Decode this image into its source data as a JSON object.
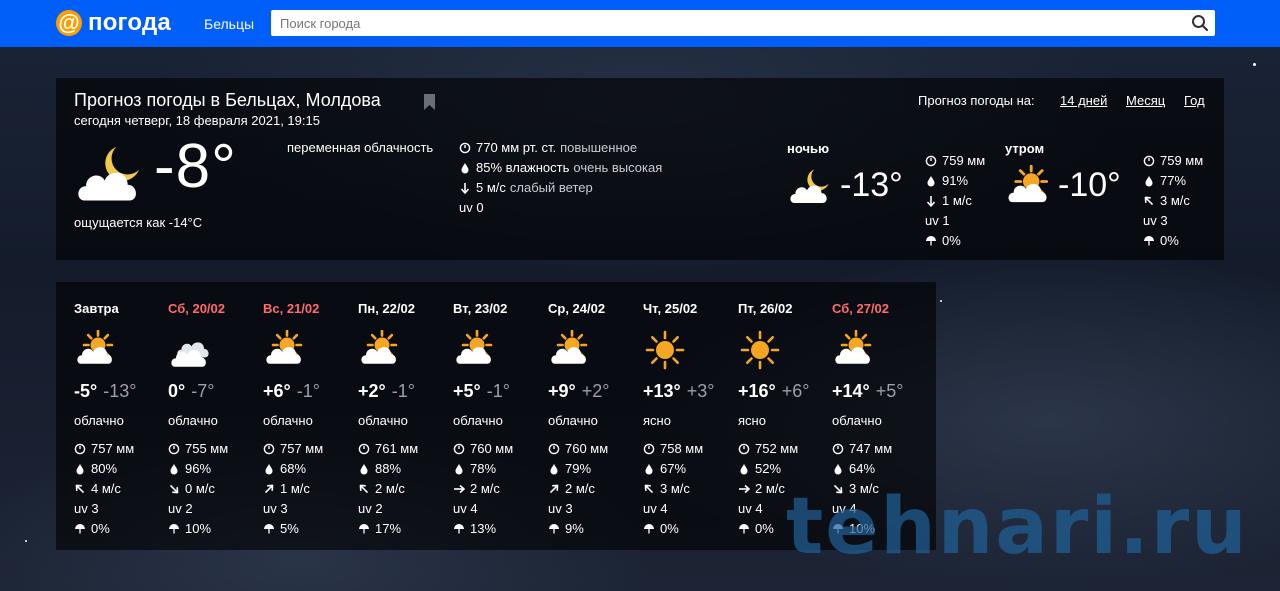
{
  "header": {
    "logo_symbol": "@",
    "logo_text": "погода",
    "city": "Бельцы",
    "search_placeholder": "Поиск города",
    "search_icon": "search-icon",
    "brand_color": "#005ff9",
    "logo_color": "#ff9e00"
  },
  "current": {
    "title": "Прогноз погоды в Бельцах, Молдова",
    "subtitle": "сегодня четверг, 18 февраля 2021, 19:15",
    "temperature": "-8°",
    "feels_like": "ощущается как -14°C",
    "condition": "переменная облачность",
    "icon": "moon-cloud-icon",
    "pressure": "770 мм рт. ст.",
    "pressure_note": "повышенное",
    "humidity": "85% влажность",
    "humidity_note": "очень высокая",
    "wind": "5 м/с",
    "wind_note": "слабый ветер",
    "uv": "uv 0"
  },
  "forecast_links": {
    "label": "Прогноз погоды на:",
    "items": [
      "14 дней",
      "Месяц",
      "Год"
    ]
  },
  "parts": [
    {
      "label": "ночью",
      "icon": "moon-cloud-icon",
      "temperature": "-13°",
      "pressure": "759 мм",
      "humidity": "91%",
      "wind": "1 м/с",
      "wind_dir": "down",
      "uv": "uv 1",
      "precip": "0%"
    },
    {
      "label": "утром",
      "icon": "sun-cloud-icon",
      "temperature": "-10°",
      "pressure": "759 мм",
      "humidity": "77%",
      "wind": "3 м/с",
      "wind_dir": "up-left",
      "uv": "uv 3",
      "precip": "0%"
    }
  ],
  "days": [
    {
      "name": "Завтра",
      "weekend": false,
      "icon": "sun-cloud-icon",
      "day": "-5°",
      "night": "-13°",
      "cond": "облачно",
      "pressure": "757 мм",
      "humidity": "80%",
      "wind": "4 м/с",
      "wind_dir": "up-left",
      "uv": "uv 3",
      "precip": "0%"
    },
    {
      "name": "Сб, 20/02",
      "weekend": true,
      "icon": "cloud-icon",
      "day": "0°",
      "night": "-7°",
      "cond": "облачно",
      "pressure": "755 мм",
      "humidity": "96%",
      "wind": "0 м/с",
      "wind_dir": "down-right",
      "uv": "uv 2",
      "precip": "10%"
    },
    {
      "name": "Вс, 21/02",
      "weekend": true,
      "icon": "sun-cloud-icon",
      "day": "+6°",
      "night": "-1°",
      "cond": "облачно",
      "pressure": "757 мм",
      "humidity": "68%",
      "wind": "1 м/с",
      "wind_dir": "up-right",
      "uv": "uv 3",
      "precip": "5%"
    },
    {
      "name": "Пн, 22/02",
      "weekend": false,
      "icon": "sun-cloud-icon",
      "day": "+2°",
      "night": "-1°",
      "cond": "облачно",
      "pressure": "761 мм",
      "humidity": "88%",
      "wind": "2 м/с",
      "wind_dir": "up-left",
      "uv": "uv 2",
      "precip": "17%"
    },
    {
      "name": "Вт, 23/02",
      "weekend": false,
      "icon": "sun-cloud-icon",
      "day": "+5°",
      "night": "-1°",
      "cond": "облачно",
      "pressure": "760 мм",
      "humidity": "78%",
      "wind": "2 м/с",
      "wind_dir": "right",
      "uv": "uv 4",
      "precip": "13%"
    },
    {
      "name": "Ср, 24/02",
      "weekend": false,
      "icon": "sun-cloud-icon",
      "day": "+9°",
      "night": "+2°",
      "cond": "облачно",
      "pressure": "760 мм",
      "humidity": "79%",
      "wind": "2 м/с",
      "wind_dir": "up-right",
      "uv": "uv 3",
      "precip": "9%"
    },
    {
      "name": "Чт, 25/02",
      "weekend": false,
      "icon": "sun-icon",
      "day": "+13°",
      "night": "+3°",
      "cond": "ясно",
      "pressure": "758 мм",
      "humidity": "67%",
      "wind": "3 м/с",
      "wind_dir": "up-left",
      "uv": "uv 4",
      "precip": "0%"
    },
    {
      "name": "Пт, 26/02",
      "weekend": false,
      "icon": "sun-icon",
      "day": "+16°",
      "night": "+6°",
      "cond": "ясно",
      "pressure": "752 мм",
      "humidity": "52%",
      "wind": "2 м/с",
      "wind_dir": "right",
      "uv": "uv 4",
      "precip": "0%"
    },
    {
      "name": "Сб, 27/02",
      "weekend": true,
      "icon": "sun-cloud-icon",
      "day": "+14°",
      "night": "+5°",
      "cond": "облачно",
      "pressure": "747 мм",
      "humidity": "64%",
      "wind": "3 м/с",
      "wind_dir": "down-right",
      "uv": "uv 4",
      "precip": "10%"
    }
  ],
  "watermark": "tehnari.ru",
  "colors": {
    "weekend": "#ff6b6b",
    "night_temp": "#9aa0a8",
    "sun": "#f5a623"
  }
}
